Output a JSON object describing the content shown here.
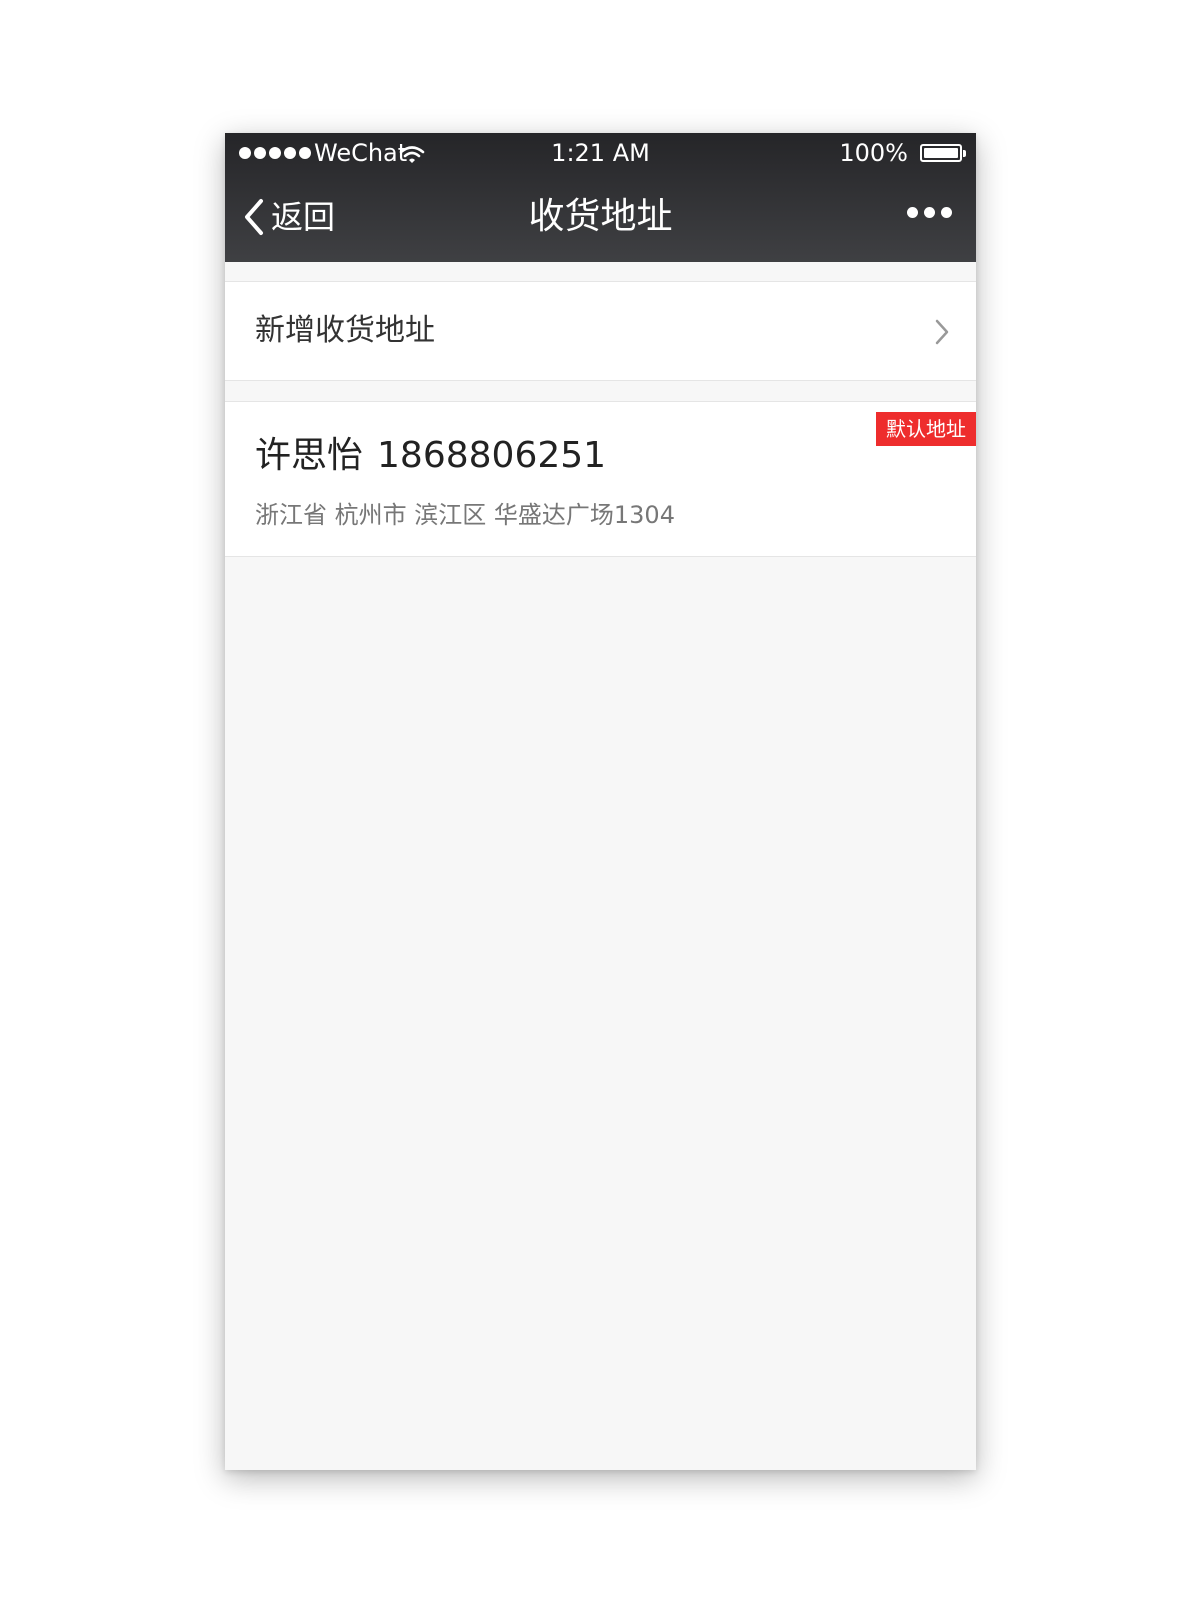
{
  "status_bar": {
    "carrier": "WeChat",
    "time": "1:21 AM",
    "battery": "100%",
    "battery_level": 1.0
  },
  "nav": {
    "back_label": "返回",
    "title": "收货地址",
    "more_icon": "ellipsis-icon"
  },
  "add_address": {
    "label": "新增收货地址",
    "icon": "chevron-right-icon"
  },
  "addresses": [
    {
      "name": "许思怡",
      "phone": "1868806251",
      "address": "浙江省 杭州市 滨江区 华盛达广场1304",
      "badge": "默认地址"
    }
  ],
  "colors": {
    "nav_bar": "#3a3a3d",
    "badge": "#ee2d2d",
    "background": "#f7f7f7"
  }
}
